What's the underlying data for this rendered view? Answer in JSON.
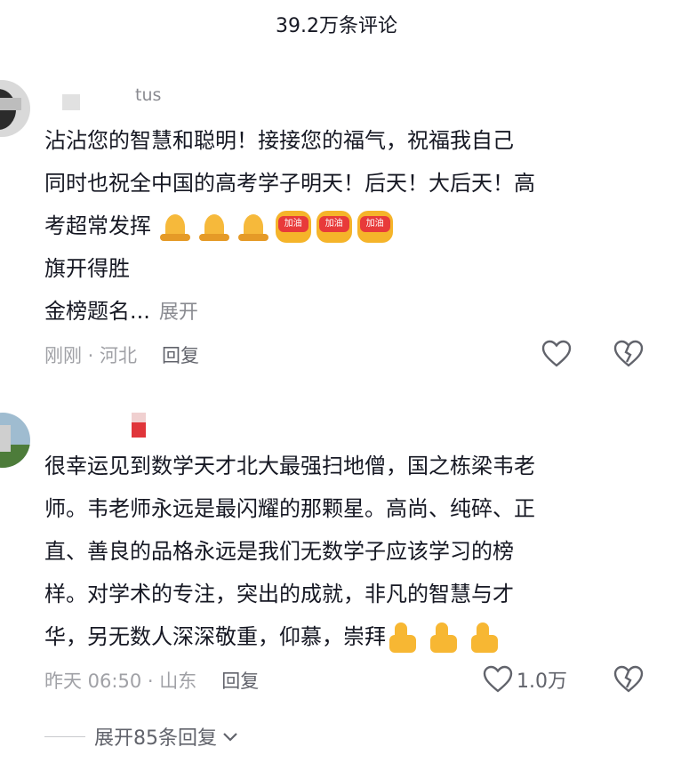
{
  "header": {
    "title": "39.2万条评论"
  },
  "comments": [
    {
      "username_visible": "tus",
      "lines": [
        "沾沾您的智慧和聪明！接接您的福气，祝福我自己",
        "同时也祝全中国的高考学子明天！后天！大后天！高",
        "考超常发挥",
        "旗开得胜",
        "金榜题名..."
      ],
      "expand_label": "展开",
      "emoji_label": "加油",
      "meta": "刚刚 · 河北",
      "reply_label": "回复"
    },
    {
      "lines": [
        "很幸运见到数学天才北大最强扫地僧，国之栋梁韦老",
        "师。韦老师永远是最闪耀的那颗星。高尚、纯碎、正",
        "直、善良的品格永远是我们无数学子应该学习的榜",
        "样。对学术的专注，突出的成就，非凡的智慧与才",
        "华，另无数人深深敬重，仰慕，崇拜"
      ],
      "meta": "昨天 06:50 · 山东",
      "reply_label": "回复",
      "like_count": "1.0万"
    }
  ],
  "expand_replies": "展开85条回复",
  "icons": {
    "like": "heart-outline-icon",
    "dislike": "broken-heart-icon",
    "chevron": "chevron-down-icon"
  },
  "colors": {
    "text": "#161823",
    "secondary": "#a0a1a6",
    "reply": "#61636b",
    "blur_red": "#e0353a",
    "emoji_yellow": "#f6b93b"
  }
}
